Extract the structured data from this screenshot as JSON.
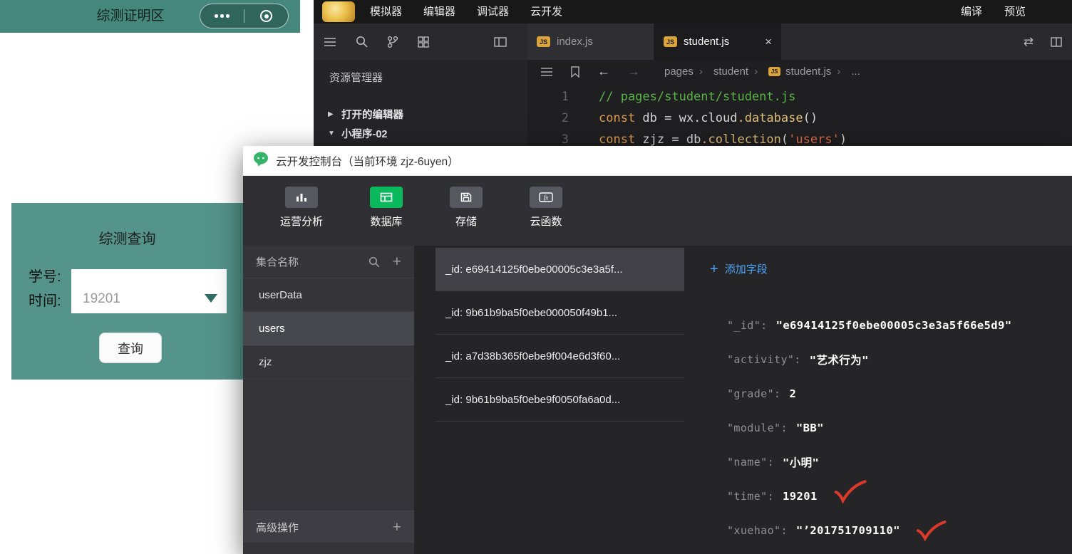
{
  "colors": {
    "teal_header": "#45887b",
    "teal_panel": "#55948a",
    "wechat_green": "#09b95c",
    "link_blue": "#4da3f7",
    "js_badge_yellow": "#dba43b",
    "annotation_red": "#db3a2b"
  },
  "icons": {
    "js_badge": "JS",
    "close": "×",
    "plus": "+",
    "chevron_right": "▶",
    "chevron_down": "▼",
    "back": "←",
    "forward": "→",
    "switch": "⇄"
  },
  "simulator": {
    "nav_title": "综测证明区",
    "form": {
      "title": "综测查询",
      "labels": {
        "xuehao": "学号:",
        "time": "时间:"
      },
      "picker_value": "19201",
      "query_button": "查询"
    }
  },
  "menubar": {
    "items": [
      {
        "label": "模拟器"
      },
      {
        "label": "编辑器"
      },
      {
        "label": "调试器"
      },
      {
        "label": "云开发"
      }
    ],
    "right": [
      {
        "label": "编译"
      },
      {
        "label": "预览"
      }
    ]
  },
  "workbench": {
    "tabs": [
      {
        "label": "index.js"
      },
      {
        "label": "student.js"
      }
    ],
    "explorer": {
      "title": "资源管理器",
      "open_editors": "打开的编辑器",
      "project": "小程序-02"
    },
    "breadcrumb": {
      "items": [
        "pages",
        "student",
        "student.js",
        "..."
      ]
    },
    "code": [
      {
        "num": "1",
        "comment": "// pages/student/student.js"
      },
      {
        "num": "2",
        "kw": "const",
        "p1": " db = wx.cloud",
        "fn": ".database",
        "p2": "()"
      },
      {
        "num": "3",
        "kw": "const",
        "p1": " zjz = db",
        "fn": ".collection",
        "p2": "(",
        "str": "'users'",
        "p3": ")"
      }
    ]
  },
  "console": {
    "title": "云开发控制台（当前环境 zjz-6uyen）",
    "nav": [
      {
        "label": "运营分析"
      },
      {
        "label": "数据库"
      },
      {
        "label": "存储"
      },
      {
        "label": "云函数"
      }
    ],
    "collections": {
      "header": "集合名称",
      "items": [
        "userData",
        "users",
        "zjz"
      ],
      "selected": "users",
      "advanced": "高级操作"
    },
    "records": [
      {
        "label": "_id: e69414125f0ebe00005c3e3a5f..."
      },
      {
        "label": "_id: 9b61b9ba5f0ebe000050f49b1..."
      },
      {
        "label": "_id: a7d38b365f0ebe9f004e6d3f60..."
      },
      {
        "label": "_id: 9b61b9ba5f0ebe9f0050fa6a0d..."
      }
    ],
    "detail": {
      "add_field": "添加字段",
      "fields": [
        {
          "key": "\"_id\":",
          "value": "\"e69414125f0ebe00005c3e3a5f66e5d9\""
        },
        {
          "key": "\"activity\":",
          "value": "\"艺术行为\""
        },
        {
          "key": "\"grade\":",
          "value": "2"
        },
        {
          "key": "\"module\":",
          "value": "\"BB\""
        },
        {
          "key": "\"name\":",
          "value": "\"小明\""
        },
        {
          "key": "\"time\":",
          "value": "19201"
        },
        {
          "key": "\"xuehao\":",
          "value": "\"’201751709110\""
        }
      ]
    }
  }
}
